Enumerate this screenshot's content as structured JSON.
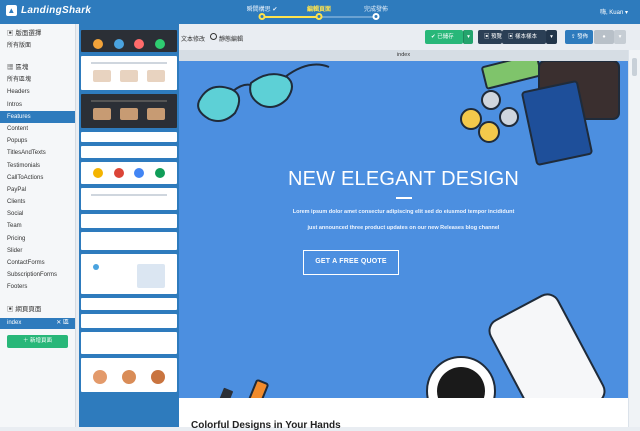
{
  "app": {
    "brand": "LandingShark"
  },
  "stepper": [
    {
      "label": "瞬間構思 ✔",
      "state": "done"
    },
    {
      "label": "編輯頁面",
      "state": "active"
    },
    {
      "label": "完成發佈",
      "state": "todo"
    }
  ],
  "user": "嗨, Kuan",
  "sidebar": {
    "section1": "版面選擇",
    "section1_sub": "所有版面",
    "section2": "區塊",
    "section2_sub": "所有區塊",
    "items": [
      "Headers",
      "Intros",
      "Features",
      "Content",
      "Popups",
      "TitlesAndTexts",
      "Testimonials",
      "CallToActions",
      "PayPal",
      "Clients",
      "Social",
      "Team",
      "Pricing",
      "Slider",
      "ContactForms",
      "SubscriptionForms",
      "Footers"
    ],
    "active_item": "Features",
    "section3": "網頁頁面",
    "page_name": "index",
    "page_close": "✕ 區",
    "add_page": "新增頁面"
  },
  "toolbar": {
    "label_text": "文本修改",
    "label_edit": "靜態編輯",
    "saved": "已儲存",
    "preview": "預覽",
    "template_mode": "樣本樣本",
    "export": "發佈"
  },
  "page_tab": "index",
  "hero": {
    "title": "NEW ELEGANT DESIGN",
    "sub1": "Lorem ipsum dolor amet consectur adipiscing elit sed do eiusmod tempor incididunt",
    "sub2": "just announced three product updates on our new Releases blog channel",
    "cta": "GET A FREE QUOTE"
  },
  "below": {
    "title": "Colorful Designs in Your Hands"
  },
  "colors": {
    "accent": "#2e7bbd",
    "hero_bg": "#4c8fe0",
    "success": "#28b779",
    "dark": "#2b3f55",
    "progress": "#ffe34d"
  }
}
